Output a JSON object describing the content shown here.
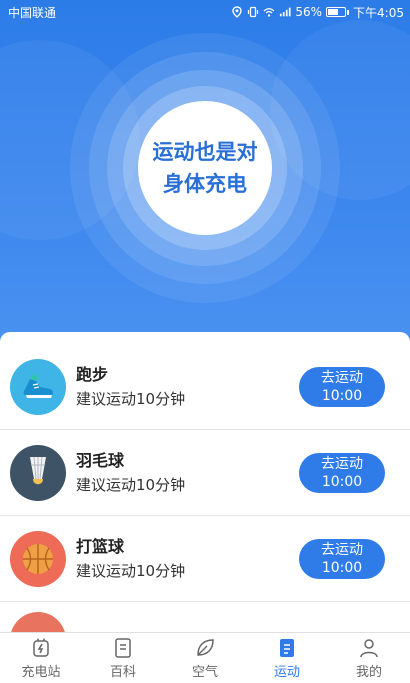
{
  "status": {
    "carrier": "中国联通",
    "battery": "56%",
    "time": "下午4:05"
  },
  "hero": {
    "line1": "运动也是对",
    "line2": "身体充电"
  },
  "activities": [
    {
      "name": "跑步",
      "desc": "建议运动10分钟",
      "btn_label": "去运动",
      "btn_time": "10:00",
      "icon": "running-shoe-icon",
      "color": "#3fb4e6"
    },
    {
      "name": "羽毛球",
      "desc": "建议运动10分钟",
      "btn_label": "去运动",
      "btn_time": "10:00",
      "icon": "shuttlecock-icon",
      "color": "#3e5366"
    },
    {
      "name": "打篮球",
      "desc": "建议运动10分钟",
      "btn_label": "去运动",
      "btn_time": "10:00",
      "icon": "basketball-icon",
      "color": "#ee6b57"
    }
  ],
  "tabs": [
    {
      "label": "充电站",
      "icon": "charging-station-icon"
    },
    {
      "label": "百科",
      "icon": "document-icon"
    },
    {
      "label": "空气",
      "icon": "leaf-icon"
    },
    {
      "label": "运动",
      "icon": "notebook-icon",
      "active": true
    },
    {
      "label": "我的",
      "icon": "person-icon"
    }
  ],
  "colors": {
    "accent": "#2f7be8",
    "hero": "#2c7ce8"
  }
}
